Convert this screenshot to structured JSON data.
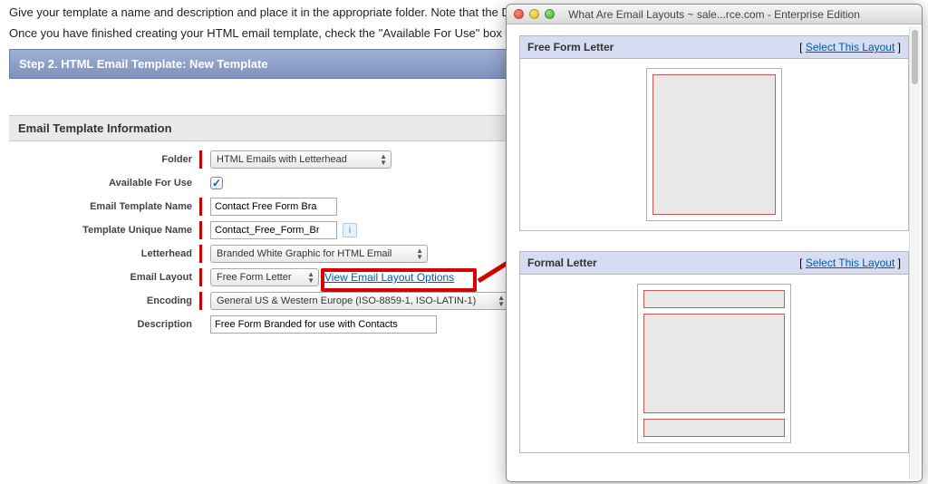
{
  "intro": {
    "line1": "Give your template a name and description and place it in the appropriate folder. Note that the Description field is for internal use only.",
    "line2": "Once you have finished creating your HTML email template, check the \"Available For Use\" box to m"
  },
  "step_header": "Step 2. HTML Email Template: New Template",
  "section_title": "Email Template Information",
  "labels": {
    "folder": "Folder",
    "available": "Available For Use",
    "template_name": "Email Template Name",
    "unique_name": "Template Unique Name",
    "letterhead": "Letterhead",
    "email_layout": "Email Layout",
    "encoding": "Encoding",
    "description": "Description"
  },
  "values": {
    "folder": "HTML Emails with Letterhead",
    "available_checked": "✓",
    "template_name": "Contact Free Form Bra",
    "unique_name": "Contact_Free_Form_Br",
    "letterhead": "Branded White Graphic for HTML Email",
    "email_layout": "Free Form Letter",
    "view_layout_link": "View Email Layout Options",
    "encoding": "General US & Western Europe (ISO-8859-1, ISO-LATIN-1)",
    "description": "Free Form Branded for use with Contacts"
  },
  "popup": {
    "title": "What Are Email Layouts ~ sale...rce.com - Enterprise Edition",
    "select_prefix": "[ ",
    "select_link": "Select This Layout",
    "select_suffix": " ]",
    "layouts": [
      {
        "name": "Free Form Letter"
      },
      {
        "name": "Formal Letter"
      }
    ]
  }
}
